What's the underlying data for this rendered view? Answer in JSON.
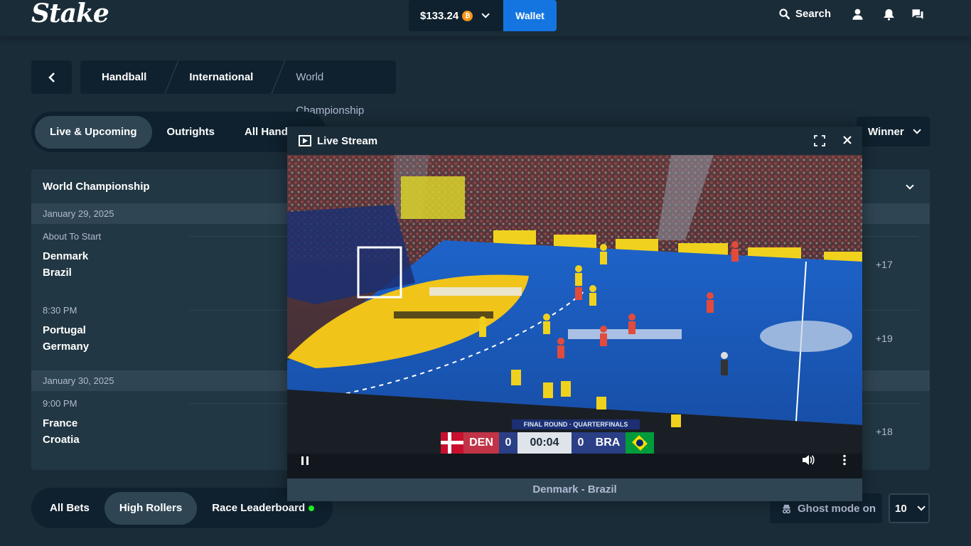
{
  "header": {
    "logo": "Stake",
    "balance": "$133.24",
    "currency_symbol": "₿",
    "wallet_label": "Wallet",
    "search_label": "Search"
  },
  "breadcrumb": {
    "items": [
      "Handball",
      "International",
      "World Championship"
    ]
  },
  "tabs": {
    "items": [
      "Live & Upcoming",
      "Outrights",
      "All Handb"
    ],
    "market_selector": "Winner"
  },
  "competition": {
    "name": "World Championship",
    "groups": [
      {
        "date": "January 29, 2025",
        "matches": [
          {
            "time": "About To Start",
            "home": "Denmark",
            "away": "Brazil",
            "more": "+17"
          },
          {
            "time": "8:30 PM",
            "home": "Portugal",
            "away": "Germany",
            "more": "+19"
          }
        ]
      },
      {
        "date": "January 30, 2025",
        "matches": [
          {
            "time": "9:00 PM",
            "home": "France",
            "away": "Croatia",
            "more": "+18"
          }
        ]
      }
    ]
  },
  "bets_tabs": {
    "items": [
      "All Bets",
      "High Rollers",
      "Race Leaderboard"
    ],
    "ghost_mode": "Ghost mode on",
    "count": "10"
  },
  "stream": {
    "title": "Live Stream",
    "match_label": "Denmark - Brazil",
    "scorebug": {
      "round": "FINAL ROUND · QUARTERFINALS",
      "home_code": "DEN",
      "home_score": "0",
      "clock": "00:04",
      "away_score": "0",
      "away_code": "BRA"
    }
  },
  "colors": {
    "bg": "#1a2c38",
    "panel": "#213743",
    "dark": "#0f212e",
    "accent": "#1475e1",
    "muted": "#b1bad3"
  }
}
